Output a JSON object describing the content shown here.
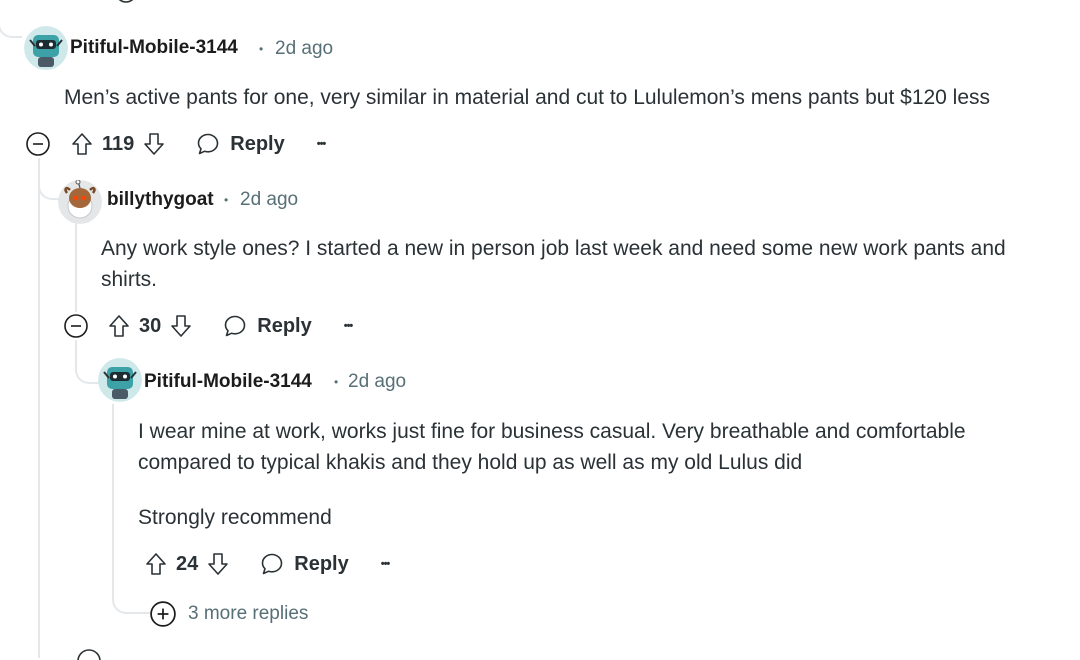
{
  "comments": [
    {
      "author": "Pitiful-Mobile-3144",
      "time": "2d ago",
      "body": [
        "Men’s active pants for one, very similar in material and cut to Lululemon’s mens pants but $120 less"
      ],
      "votes": "119",
      "reply_label": "Reply",
      "more_label": "•••"
    },
    {
      "author": "billythygoat",
      "time": "2d ago",
      "body": [
        "Any work style ones? I started a new in person job last week and need some new work pants and shirts."
      ],
      "votes": "30",
      "reply_label": "Reply",
      "more_label": "•••"
    },
    {
      "author": "Pitiful-Mobile-3144",
      "time": "2d ago",
      "body": [
        "I wear mine at work, works just fine for business casual. Very breathable and comfortable compared to typical khakis and they hold up as well as my old Lulus did",
        "Strongly recommend"
      ],
      "votes": "24",
      "reply_label": "Reply",
      "more_label": "•••"
    }
  ],
  "more_replies_label": "3 more replies",
  "separator": "•",
  "colors": {
    "meta": "#576f76",
    "thread_line": "#e5e8eb",
    "text": "#2a3236"
  }
}
